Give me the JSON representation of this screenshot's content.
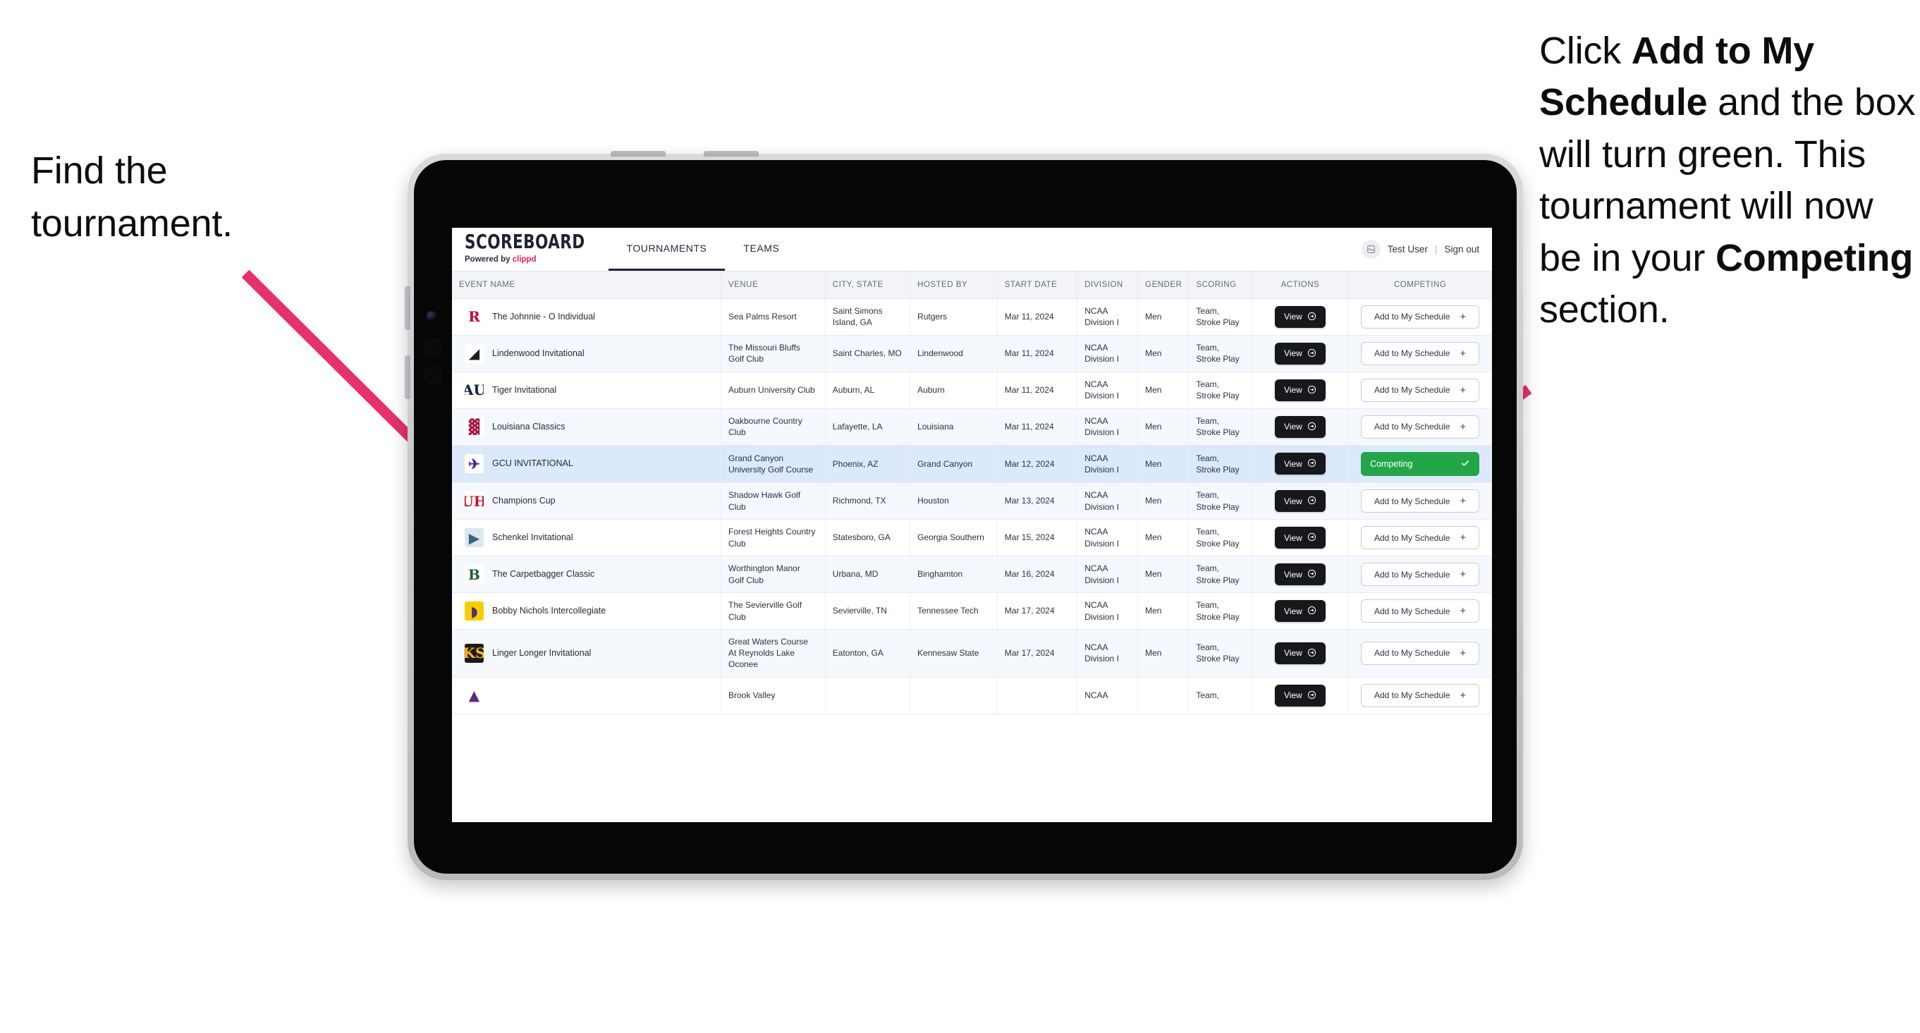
{
  "annotations": {
    "left": {
      "line1": "Find the",
      "line2": "tournament."
    },
    "right": {
      "seg1": "Click ",
      "bold1": "Add to My Schedule",
      "seg2": " and the box will turn green. This tournament will now be in your ",
      "bold2": "Competing",
      "seg3": " section."
    },
    "arrow_color": "#e8306b"
  },
  "app": {
    "brand": {
      "title": "SCOREBOARD",
      "powered_prefix": "Powered by",
      "powered_brand": "clippd"
    },
    "tabs": [
      {
        "label": "TOURNAMENTS",
        "active": true
      },
      {
        "label": "TEAMS",
        "active": false
      }
    ],
    "user": {
      "avatar_icon": "user-avatar-icon",
      "name": "Test User",
      "separator": "|",
      "signout": "Sign out"
    },
    "accent_green": "#23a648",
    "selected_row_bg": "#dce8fb"
  },
  "table": {
    "columns": [
      "EVENT NAME",
      "VENUE",
      "CITY, STATE",
      "HOSTED BY",
      "START DATE",
      "DIVISION",
      "GENDER",
      "SCORING",
      "ACTIONS",
      "COMPETING"
    ],
    "buttons": {
      "view": "View",
      "view_icon": "arrow-right-circle-icon",
      "add": "Add to My Schedule",
      "add_icon": "plus-icon",
      "competing": "Competing",
      "competing_icon": "check-icon"
    },
    "rows": [
      {
        "event": "The Johnnie - O Individual",
        "logo_text": "R",
        "logo_fg": "#cc0033",
        "logo_bg": "#ffffff",
        "venue": "Sea Palms Resort",
        "city": "Saint Simons Island, GA",
        "hosted_by": "Rutgers",
        "start_date": "Mar 11, 2024",
        "division": "NCAA Division I",
        "gender": "Men",
        "scoring": "Team, Stroke Play",
        "competing": false
      },
      {
        "event": "Lindenwood Invitational",
        "logo_text": "◢",
        "logo_fg": "#1d1d1b",
        "logo_bg": "#ffffff",
        "venue": "The Missouri Bluffs Golf Club",
        "city": "Saint Charles, MO",
        "hosted_by": "Lindenwood",
        "start_date": "Mar 11, 2024",
        "division": "NCAA Division I",
        "gender": "Men",
        "scoring": "Team, Stroke Play",
        "competing": false
      },
      {
        "event": "Tiger Invitational",
        "logo_text": "AU",
        "logo_fg": "#0c2340",
        "logo_bg": "#ffffff",
        "venue": "Auburn University Club",
        "city": "Auburn, AL",
        "hosted_by": "Auburn",
        "start_date": "Mar 11, 2024",
        "division": "NCAA Division I",
        "gender": "Men",
        "scoring": "Team, Stroke Play",
        "competing": false
      },
      {
        "event": "Louisiana Classics",
        "logo_text": "▓",
        "logo_fg": "#a4123f",
        "logo_bg": "#ffffff",
        "venue": "Oakbourne Country Club",
        "city": "Lafayette, LA",
        "hosted_by": "Louisiana",
        "start_date": "Mar 11, 2024",
        "division": "NCAA Division I",
        "gender": "Men",
        "scoring": "Team, Stroke Play",
        "competing": false
      },
      {
        "event": "GCU INVITATIONAL",
        "logo_text": "✈",
        "logo_fg": "#522398",
        "logo_bg": "#ffffff",
        "venue": "Grand Canyon University Golf Course",
        "city": "Phoenix, AZ",
        "hosted_by": "Grand Canyon",
        "start_date": "Mar 12, 2024",
        "division": "NCAA Division I",
        "gender": "Men",
        "scoring": "Team, Stroke Play",
        "competing": true,
        "selected": true
      },
      {
        "event": "Champions Cup",
        "logo_text": "UH",
        "logo_fg": "#c8102e",
        "logo_bg": "#ffffff",
        "venue": "Shadow Hawk Golf Club",
        "city": "Richmond, TX",
        "hosted_by": "Houston",
        "start_date": "Mar 13, 2024",
        "division": "NCAA Division I",
        "gender": "Men",
        "scoring": "Team, Stroke Play",
        "competing": false
      },
      {
        "event": "Schenkel Invitational",
        "logo_text": "▶",
        "logo_fg": "#37657f",
        "logo_bg": "#dce7ef",
        "venue": "Forest Heights Country Club",
        "city": "Statesboro, GA",
        "hosted_by": "Georgia Southern",
        "start_date": "Mar 15, 2024",
        "division": "NCAA Division I",
        "gender": "Men",
        "scoring": "Team, Stroke Play",
        "competing": false
      },
      {
        "event": "The Carpetbagger Classic",
        "logo_text": "B",
        "logo_fg": "#1f5c3d",
        "logo_bg": "#ffffff",
        "venue": "Worthington Manor Golf Club",
        "city": "Urbana, MD",
        "hosted_by": "Binghamton",
        "start_date": "Mar 16, 2024",
        "division": "NCAA Division I",
        "gender": "Men",
        "scoring": "Team, Stroke Play",
        "competing": false
      },
      {
        "event": "Bobby Nichols Intercollegiate",
        "logo_text": "◗",
        "logo_fg": "#5b2b82",
        "logo_bg": "#f5d000",
        "venue": "The Sevierville Golf Club",
        "city": "Sevierville, TN",
        "hosted_by": "Tennessee Tech",
        "start_date": "Mar 17, 2024",
        "division": "NCAA Division I",
        "gender": "Men",
        "scoring": "Team, Stroke Play",
        "competing": false
      },
      {
        "event": "Linger Longer Invitational",
        "logo_text": "KS",
        "logo_fg": "#ffb81c",
        "logo_bg": "#1a1a1a",
        "venue": "Great Waters Course At Reynolds Lake Oconee",
        "city": "Eatonton, GA",
        "hosted_by": "Kennesaw State",
        "start_date": "Mar 17, 2024",
        "division": "NCAA Division I",
        "gender": "Men",
        "scoring": "Team, Stroke Play",
        "competing": false
      },
      {
        "event": "",
        "logo_text": "▲",
        "logo_fg": "#5b2b82",
        "logo_bg": "#ffffff",
        "venue": "Brook Valley",
        "city": "",
        "hosted_by": "",
        "start_date": "",
        "division": "NCAA",
        "gender": "",
        "scoring": "Team,",
        "competing": false,
        "clipped": true
      }
    ]
  }
}
